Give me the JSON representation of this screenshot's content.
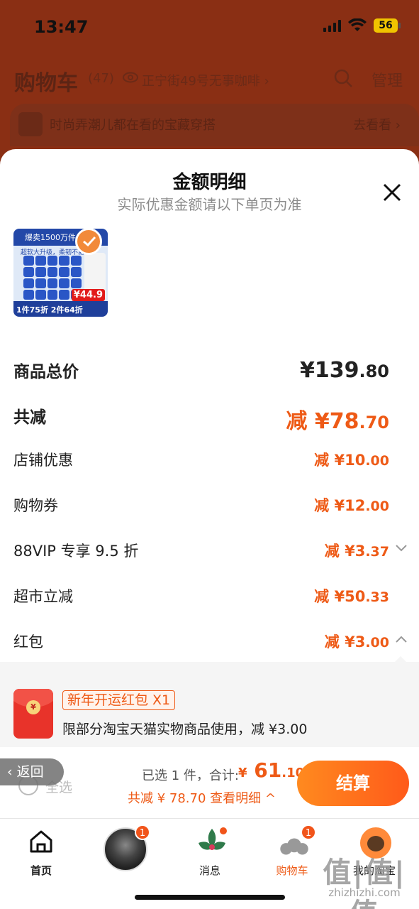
{
  "status_bar": {
    "time": "13:47",
    "battery": "56"
  },
  "header": {
    "title": "购物车",
    "count": "(47)",
    "location": "正宁街49号无事咖啡 ›",
    "manage": "管理"
  },
  "promo": {
    "text": "时尚弄潮儿都在看的宝藏穿搭",
    "link": "去看看 ›"
  },
  "sheet": {
    "title": "金额明细",
    "subtitle": "实际优惠金额请以下单页为准"
  },
  "product": {
    "top_text": "爆卖1500万件+",
    "sub_text": "超软大升级，柔韧不易破",
    "bottom_text": "1件75折 2件64折",
    "price_tag": "¥44.9"
  },
  "rows": [
    {
      "label": "商品总价",
      "value_main": "¥139",
      "value_dec": ".80"
    },
    {
      "label": "共减",
      "value_main": "减 ¥78",
      "value_dec": ".70"
    },
    {
      "label": "店铺优惠",
      "value_main": "减 ¥10",
      "value_dec": ".00"
    },
    {
      "label": "购物券",
      "value_main": "减 ¥12",
      "value_dec": ".00"
    },
    {
      "label": "88VIP 专享 9.5 折",
      "value_main": "减 ¥3",
      "value_dec": ".37"
    },
    {
      "label": "超市立减",
      "value_main": "减 ¥50",
      "value_dec": ".33"
    },
    {
      "label": "红包",
      "value_main": "减 ¥3",
      "value_dec": ".00"
    }
  ],
  "red_packet": {
    "envelope_symbol": "¥",
    "tag": "新年开运红包 X1",
    "desc": "限部分淘宝天猫实物商品使用，减 ¥3.00"
  },
  "checkout": {
    "back": "返回",
    "select_all": "全选",
    "selected": "已选 1 件，合计:",
    "currency": "¥",
    "total_main": "61",
    "total_dec": ".10",
    "discount": "共减 ¥ 78.70  查看明细 ^",
    "pay": "结算"
  },
  "tabs": {
    "home": "首页",
    "avatar_badge": "1",
    "messages": "消息",
    "cart": "购物车",
    "cart_badge": "1",
    "me": "我的淘宝"
  },
  "watermark": {
    "logo": "值|值|值",
    "url": "zhizhizhi.com"
  },
  "colors": {
    "accent": "#ee5a16",
    "pay_button": "#ff6a1a",
    "overlay": "#8a2f14"
  }
}
